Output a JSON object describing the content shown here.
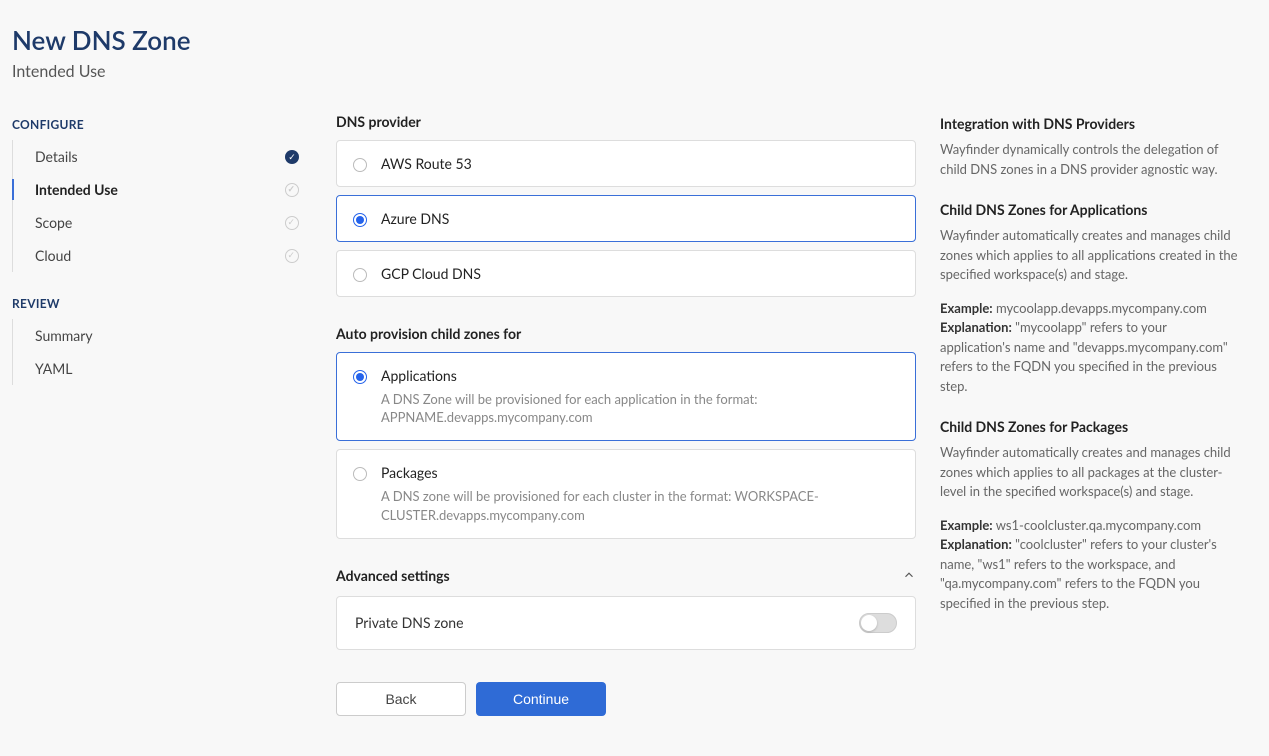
{
  "header": {
    "title": "New DNS Zone",
    "subtitle": "Intended Use"
  },
  "sidebar": {
    "configure_label": "CONFIGURE",
    "review_label": "REVIEW",
    "configure": [
      {
        "label": "Details",
        "status": "done"
      },
      {
        "label": "Intended Use",
        "status": "active"
      },
      {
        "label": "Scope",
        "status": "pending"
      },
      {
        "label": "Cloud",
        "status": "pending"
      }
    ],
    "review": [
      {
        "label": "Summary"
      },
      {
        "label": "YAML"
      }
    ]
  },
  "form": {
    "provider_label": "DNS provider",
    "providers": [
      {
        "label": "AWS Route 53",
        "selected": false
      },
      {
        "label": "Azure DNS",
        "selected": true
      },
      {
        "label": "GCP Cloud DNS",
        "selected": false
      }
    ],
    "autoprovision_label": "Auto provision child zones for",
    "autoprovision": [
      {
        "label": "Applications",
        "desc": "A DNS Zone will be provisioned for each application in the format: APPNAME.devapps.mycompany.com",
        "selected": true
      },
      {
        "label": "Packages",
        "desc": "A DNS zone will be provisioned for each cluster in the format: WORKSPACE-CLUSTER.devapps.mycompany.com",
        "selected": false
      }
    ],
    "advanced_label": "Advanced settings",
    "private_dns_label": "Private DNS zone",
    "private_dns_on": false,
    "back_label": "Back",
    "continue_label": "Continue"
  },
  "help": {
    "h1": "Integration with DNS Providers",
    "p1": "Wayfinder dynamically controls the delegation of child DNS zones in a DNS provider agnostic way.",
    "h2": "Child DNS Zones for Applications",
    "p2": "Wayfinder automatically creates and manages child zones which applies to all applications created in the specified workspace(s) and stage.",
    "ex_label": "Example:",
    "ex1": "mycoolapp.devapps.mycompany.com",
    "expl_label": "Explanation:",
    "expl1": "\"mycoolapp\" refers to your application's name and \"devapps.mycompany.com\" refers to the FQDN you specified in the previous step.",
    "h3": "Child DNS Zones for Packages",
    "p3": "Wayfinder automatically creates and manages child zones which applies to all packages at the cluster-level in the specified workspace(s) and stage.",
    "ex2": "ws1-coolcluster.qa.mycompany.com",
    "expl2": "\"coolcluster\" refers to your cluster's name, \"ws1\" refers to the workspace, and \"qa.mycompany.com\" refers to the FQDN you specified in the previous step."
  }
}
